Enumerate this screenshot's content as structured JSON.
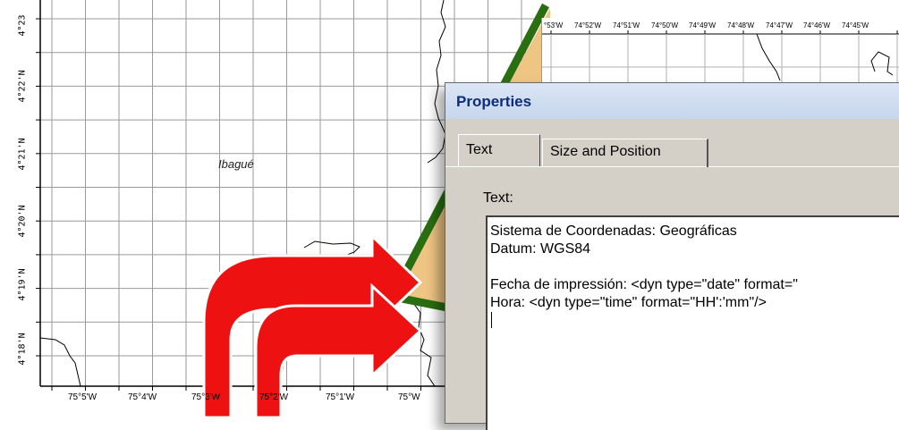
{
  "left_map": {
    "lat_labels": [
      "4°23",
      "4°22'N",
      "4°21'N",
      "4°20'N",
      "4°19'N",
      "4°18'N"
    ],
    "lon_labels": [
      "75°5'W",
      "75°4'W",
      "75°3'W",
      "75°2'W",
      "75°1'W",
      "75°W"
    ],
    "city_label": "Ibagué"
  },
  "right_map": {
    "lon_labels": [
      "°53'W",
      "74°52'W",
      "74°51'W",
      "74°50'W",
      "74°49'W",
      "74°48'W",
      "74°47'W",
      "74°46'W",
      "74°45'W"
    ]
  },
  "colors": {
    "highlight_fill": "#efc584",
    "highlight_stroke": "#2a6e12",
    "arrow": "#ee1111",
    "dialog_bg": "#d4d0c8",
    "title_text": "#0b2c80"
  },
  "dialog": {
    "title": "Properties",
    "tabs": [
      {
        "label": "Text",
        "active": true
      },
      {
        "label": "Size and Position",
        "active": false
      }
    ],
    "text_label": "Text:",
    "text_lines": [
      "Sistema de Coordenadas: Geográficas",
      "Datum: WGS84",
      "",
      "Fecha de impressión: <dyn type=\"date\" format=\"",
      "Hora: <dyn type=\"time\" format=\"HH':'mm\"/>"
    ]
  }
}
